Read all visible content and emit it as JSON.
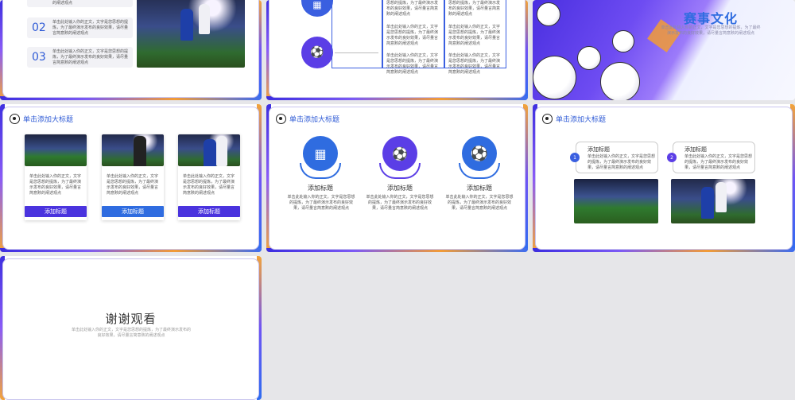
{
  "slide1": {
    "rows": [
      {
        "num": "02",
        "text": "单击此处输入你的正文，文字是您思想的提炼，为了最终演示发布的良好效果，请尽量言简意赅的阐述观点"
      },
      {
        "num": "03",
        "text": "单击此处输入你的正文，文字是您思想的提炼，为了最终演示发布的良好效果，请尽量言简意赅的阐述观点"
      }
    ],
    "top_text": "的阐述观点"
  },
  "slide2": {
    "col1_blocks": [
      "思想的提炼，为了最终演示发布的良好效果，请尽量言简意赅的阐述观点",
      "单击此处输入你的正文，文字是您思想的提炼，为了最终演示发布的良好效果，请尽量言简意赅的阐述观点",
      "单击此处输入你的正文，文字是您思想的提炼，为了最终演示发布的良好效果，请尽量言简意赅的阐述观点"
    ],
    "col2_blocks": [
      "思想的提炼，为了最终演示发布的良好效果，请尽量言简意赅的阐述观点",
      "单击此处输入你的正文，文字是您思想的提炼，为了最终演示发布的良好效果，请尽量言简意赅的阐述观点",
      "单击此处输入你的正文，文字是您思想的提炼，为了最终演示发布的良好效果，请尽量言简意赅的阐述观点"
    ]
  },
  "slide3": {
    "title": "赛事文化",
    "text": "单击此处输入你的正文，文字是您思想的提炼，为了最终演示发布的良好效果，请尽量言简意赅的阐述观点"
  },
  "slide4": {
    "header": "单击添加大标题",
    "cards": [
      {
        "text": "单击此处输入你的正文，文字是您思想的提炼，为了最终演示发布的良好效果，请尽量言简意赅的阐述观点",
        "button": "添加标题"
      },
      {
        "text": "单击此处输入你的正文，文字是您思想的提炼，为了最终演示发布的良好效果，请尽量言简意赅的阐述观点",
        "button": "添加标题"
      },
      {
        "text": "单击此处输入你的正文，文字是您思想的提炼，为了最终演示发布的良好效果，请尽量言简意赅的阐述观点",
        "button": "添加标题"
      }
    ]
  },
  "slide5": {
    "header": "单击添加大标题",
    "items": [
      {
        "title": "添加标题",
        "text": "单击此处输入你的正文，文字是您思想的提炼，为了最终演示发布的良好效果，请尽量言简意赅的阐述观点",
        "icon": "goal-net-icon"
      },
      {
        "title": "添加标题",
        "text": "单击此处输入你的正文，文字是您思想的提炼，为了最终演示发布的良好效果，请尽量言简意赅的阐述观点",
        "icon": "ball-net-icon"
      },
      {
        "title": "添加标题",
        "text": "单击此处输入你的正文，文字是您思想的提炼，为了最终演示发布的良好效果，请尽量言简意赅的阐述观点",
        "icon": "soccer-ball-icon"
      }
    ]
  },
  "slide6": {
    "header": "单击添加大标题",
    "boxes": [
      {
        "num": "1",
        "title": "添加标题",
        "text": "单击此处输入你的正文，文字是您思想的提炼，为了最终演示发布的良好效果，请尽量言简意赅的阐述观点"
      },
      {
        "num": "2",
        "title": "添加标题",
        "text": "单击此处输入你的正文，文字是您思想的提炼，为了最终演示发布的良好效果，请尽量言简意赅的阐述观点"
      }
    ]
  },
  "slide7": {
    "title": "谢谢观看",
    "text": "单击此处输入你的正文，文字是您思想的提炼，为了最终演示发布的良好效果，请尽量言简意赅的阐述观点"
  },
  "colors": {
    "accent": "#4a33de",
    "blue": "#2f5bd6",
    "brand_purple": "#5b3ee6"
  }
}
